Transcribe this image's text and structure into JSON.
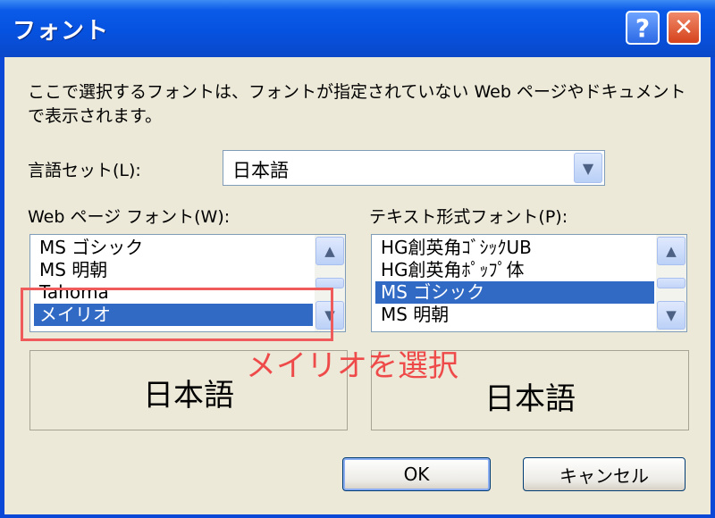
{
  "window": {
    "title": "フォント",
    "help_glyph": "?",
    "close_glyph": "✕"
  },
  "description": "ここで選択するフォントは、フォントが指定されていない Web ページやドキュメントで表示されます。",
  "language_set": {
    "label": "言語セット(L):",
    "value": "日本語"
  },
  "web_font": {
    "label": "Web ページ フォント(W):",
    "items": [
      "MS ゴシック",
      "MS 明朝",
      "Tahoma",
      "メイリオ"
    ],
    "selected": "メイリオ",
    "preview": "日本語"
  },
  "text_font": {
    "label": "テキスト形式フォント(P):",
    "items": [
      "HG創英角ｺﾞｼｯｸUB",
      "HG創英角ﾎﾟｯﾌﾟ体",
      "MS ゴシック",
      "MS 明朝"
    ],
    "selected": "MS ゴシック",
    "preview": "日本語"
  },
  "buttons": {
    "ok": "OK",
    "cancel": "キャンセル"
  },
  "annotation": "メイリオを選択",
  "icons": {
    "up": "▲",
    "down": "▼"
  },
  "colors": {
    "selection": "#316ac5",
    "annotation": "#ef4a4a",
    "titlebar": "#0652e0"
  }
}
